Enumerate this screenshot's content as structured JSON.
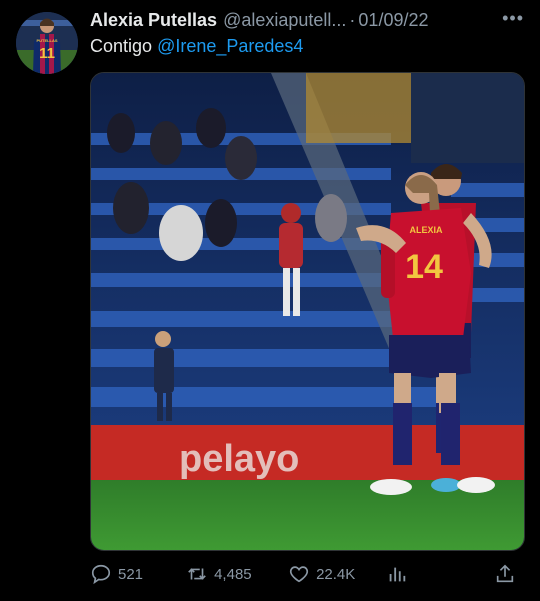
{
  "author": {
    "name": "Alexia Putellas",
    "handle": "@alexiaputell...",
    "separator": "·",
    "date": "01/09/22",
    "avatar_jersey_name": "PUTELLAS",
    "avatar_jersey_number": "11"
  },
  "more_icon": "more-horizontal-icon",
  "tweet": {
    "text": "Contigo",
    "mention": "@Irene_Paredes4"
  },
  "media": {
    "jersey_name": "ALEXIA",
    "jersey_number": "14",
    "ad_board_text": "pelayo"
  },
  "actions": {
    "replies": "521",
    "retweets": "4,485",
    "likes": "22.4K",
    "views_icon": "analytics-icon",
    "share_icon": "share-icon"
  },
  "colors": {
    "background": "#000000",
    "text": "#e7e9ea",
    "muted": "#8b98a5",
    "link": "#1d9bf0",
    "spain_red": "#c8102e",
    "spain_navy": "#1a1f5a"
  }
}
